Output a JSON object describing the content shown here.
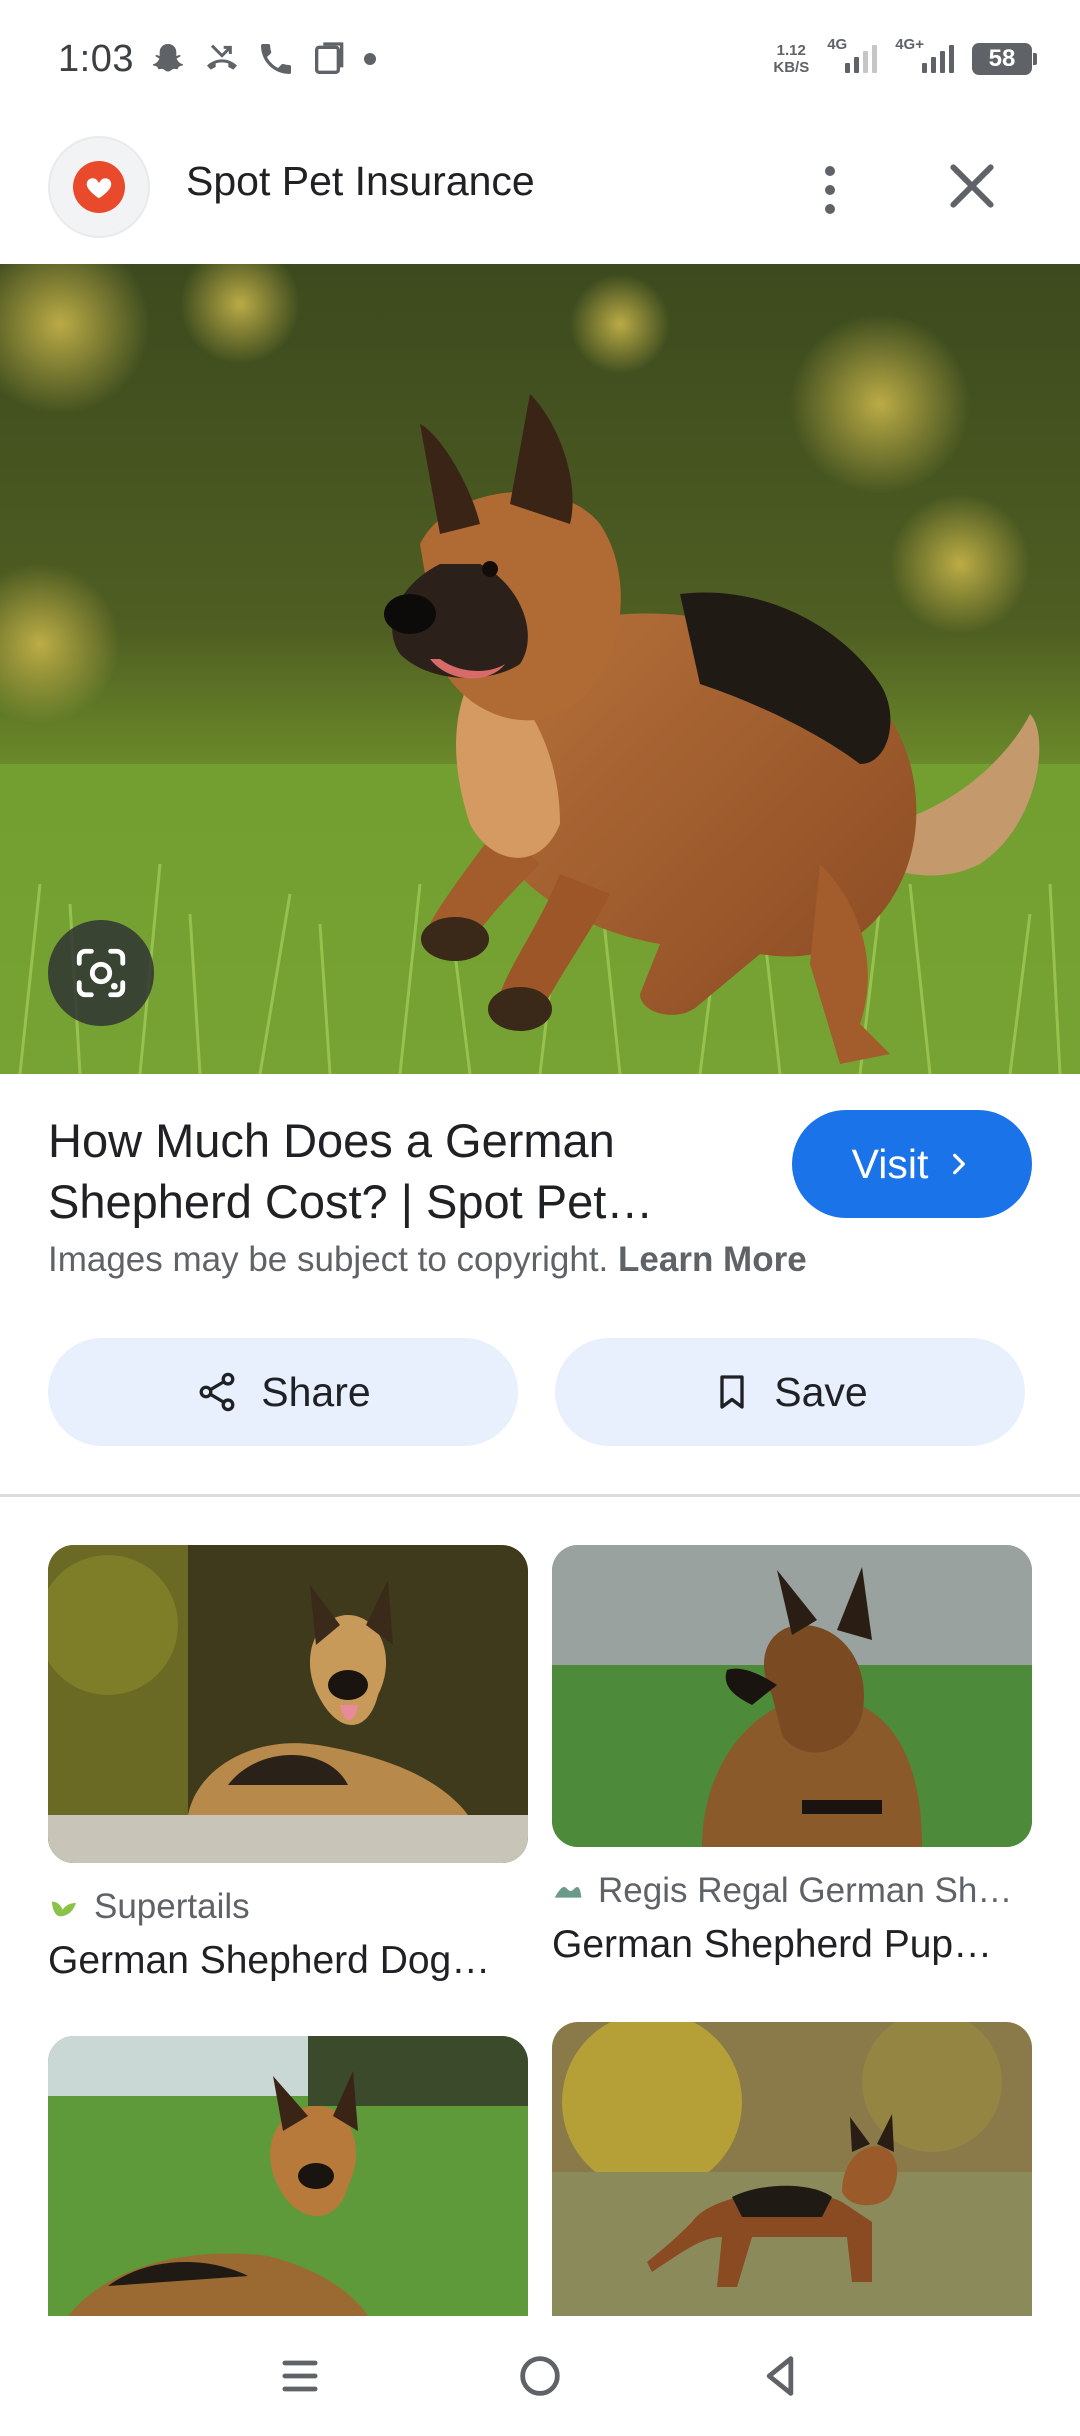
{
  "status_bar": {
    "time": "1:03",
    "net_speed_value": "1.12",
    "net_speed_unit": "KB/S",
    "signal_1_label": "4G",
    "signal_2_label": "4G+",
    "battery_level": "58",
    "icons": [
      "snapchat-icon",
      "missed-call-icon",
      "phone-icon",
      "screenshot-icon"
    ]
  },
  "header": {
    "site_name": "Spot Pet Insurance",
    "logo_icon": "heart-icon",
    "logo_color": "#ea4a2c"
  },
  "result": {
    "title": "How Much Does a German Shepherd Cost? | Spot Pet…",
    "visit_label": "Visit",
    "copyright_text": "Images may be subject to copyright.",
    "learn_more_label": "Learn More",
    "share_label": "Share",
    "save_label": "Save"
  },
  "related": [
    {
      "source": "Supertails",
      "title": "German Shepherd Dog…"
    },
    {
      "source": "Regis Regal German Sh…",
      "title": "German Shepherd Pup…"
    },
    {
      "source": "",
      "title": ""
    },
    {
      "source": "",
      "title": ""
    }
  ],
  "colors": {
    "accent": "#1a73e8",
    "chip_bg": "#e8f0fe"
  }
}
